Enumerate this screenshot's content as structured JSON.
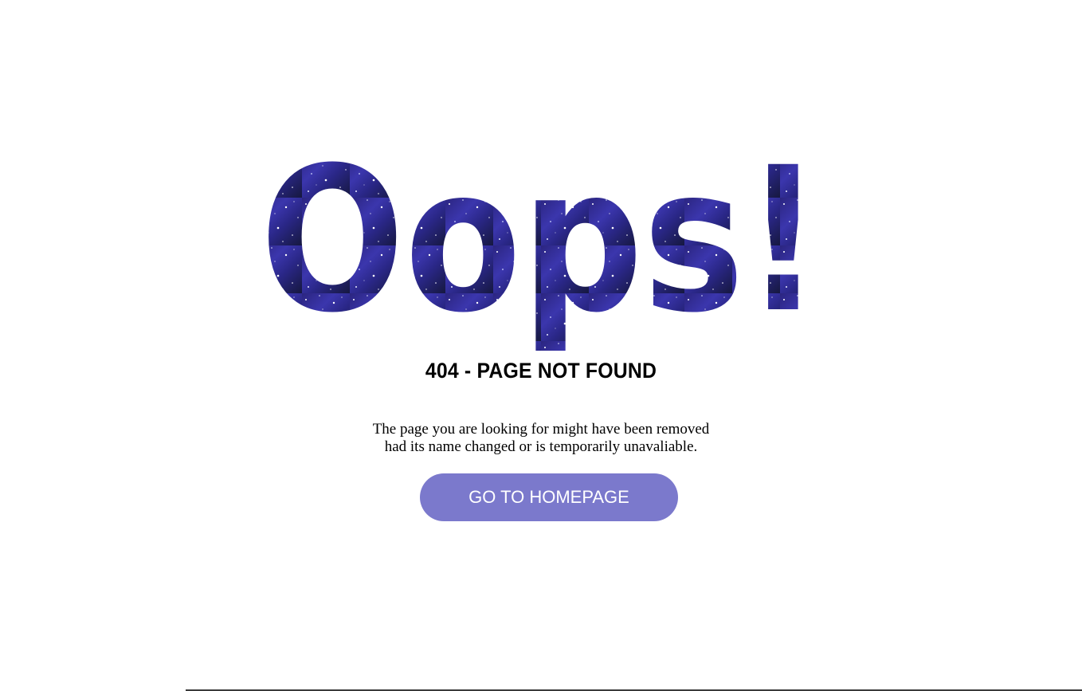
{
  "hero": {
    "text": "Oops!",
    "fill_colors": [
      "#27216e",
      "#3a33a8",
      "#1a1846",
      "#4a4fc8"
    ]
  },
  "error": {
    "title": "404 - PAGE NOT FOUND",
    "message_line1": "The page you are looking for might have been removed",
    "message_line2": "had its name changed or is temporarily unavaliable."
  },
  "actions": {
    "home_label": "GO TO HOMEPAGE",
    "button_color": "#7b79cc"
  }
}
